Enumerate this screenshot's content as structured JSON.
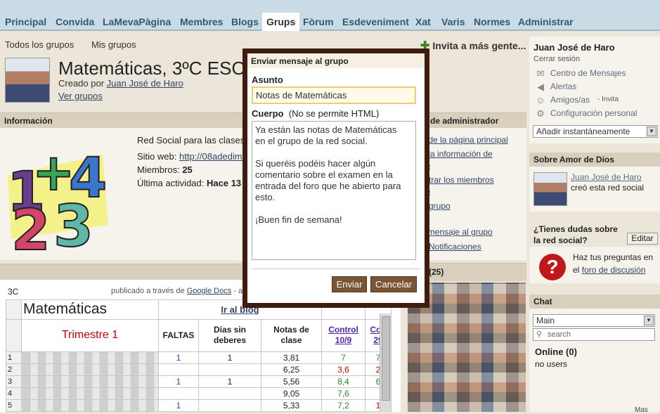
{
  "nav": {
    "tabs": [
      "Principal",
      "Convida",
      "LaMevaPàgina",
      "Membres",
      "Blogs",
      "Grups",
      "Fòrum",
      "Esdeveniment",
      "Xat",
      "Varis",
      "Normes",
      "Administrar"
    ],
    "active": "Grups"
  },
  "subnav": {
    "all_groups": "Todos los grupos",
    "my_groups": "Mis grupos",
    "invite": "Invita a más gente..."
  },
  "group": {
    "title": "Matemáticas, 3ºC ESO",
    "created_by_prefix": "Creado por",
    "creator": "Juan José de Haro",
    "view_groups": "Ver grupos"
  },
  "info": {
    "heading": "Información",
    "description": "Red Social para las clases",
    "website_label": "Sitio web:",
    "website": "http://08adedimi",
    "members_label": "Miembros:",
    "members": "25",
    "activity_label": "Última actividad:",
    "activity": "Hace 13"
  },
  "doc": {
    "source": "3C",
    "published_via": "publicado a través de",
    "published_link": "Google Docs",
    "published_suffix": "- a"
  },
  "sheet": {
    "title": "Matemáticas",
    "blog_link": "Ir al blog",
    "term": "Trimestre 1",
    "headers": [
      "FALTAS",
      "Días sin deberes",
      "Notas de clase",
      "Control 10/9",
      "Con 29"
    ],
    "rows": [
      {
        "n": "1",
        "faltas": "1",
        "dias": "1",
        "notas": "3,81",
        "c1": "7",
        "c2": "7"
      },
      {
        "n": "2",
        "faltas": "",
        "dias": "",
        "notas": "6,25",
        "c1": "3,6",
        "c2": "2"
      },
      {
        "n": "3",
        "faltas": "1",
        "dias": "1",
        "notas": "5,56",
        "c1": "8,4",
        "c2": "6"
      },
      {
        "n": "4",
        "faltas": "",
        "dias": "",
        "notas": "9,05",
        "c1": "7,6",
        "c2": ""
      },
      {
        "n": "5",
        "faltas": "1",
        "dias": "",
        "notas": "5,33",
        "c1": "7,2",
        "c2": "1"
      }
    ]
  },
  "admin": {
    "heading": "nes de administrador",
    "links": [
      "tar de la página principal",
      "tar la información de",
      "upo",
      "inistrar los miembros",
      "upo",
      "rar grupo",
      "iar mensaje al grupo",
      "rar Notificaciones"
    ],
    "members_heading": "ros (25)"
  },
  "user": {
    "name": "Juan José de Haro",
    "logout": "Cerrar sesión",
    "links": [
      {
        "icon": "mail-icon",
        "label": "Centro de Mensajes"
      },
      {
        "icon": "alert-icon",
        "label": "Alertas"
      },
      {
        "icon": "friends-icon",
        "label": "Amigos/as",
        "extra": "- Invita"
      },
      {
        "icon": "gear-icon",
        "label": "Configuración personal"
      }
    ],
    "add_instant": "Añadir instantáneamente"
  },
  "about": {
    "heading": "Sobre Amor de Dios",
    "creator": "Juan José de Haro",
    "creator_suffix": "creó esta red social"
  },
  "help": {
    "heading": "¿Tienes dudas sobre la red social?",
    "edit": "Editar",
    "text_prefix": "Haz tus preguntas en el",
    "link": "foro de discusión"
  },
  "chat": {
    "heading": "Chat",
    "room": "Main",
    "search_placeholder": "search",
    "online": "Online (0)",
    "nobody": "no users"
  },
  "dialog": {
    "title": "Enviar mensaje al grupo",
    "subject_label": "Asunto",
    "subject": "Notas de Matemáticas",
    "body_label": "Cuerpo",
    "body_note": "(No se permite HTML)",
    "body": "Ya están las notas de Matemáticas\nen el grupo de la red social.\n\nSi queréis podéis hacer algún\ncomentario sobre el examen en la\nentrada del foro que he abierto para\nesto.\n\n¡Buen fin de semana!",
    "send": "Enviar",
    "cancel": "Cancelar"
  },
  "footer": {
    "more": "Mas"
  },
  "colors": {
    "dialog_border": "#3e1d0e",
    "button": "#7a5535",
    "nav_bg": "#c9dbe4",
    "section_head": "#d8d0bd"
  }
}
